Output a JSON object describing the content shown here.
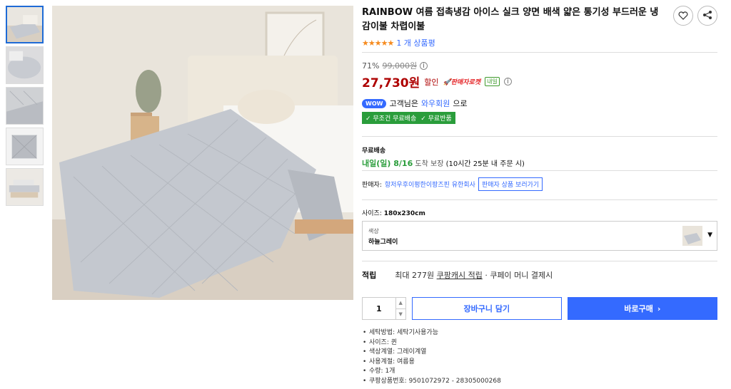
{
  "product": {
    "title": "RAINBOW 여름 접촉냉감 아이스 실크 양면 배색 얇은 통기성 부드러운 냉감이불 차렵이불",
    "stars": "★★★★★",
    "review_count": "1 개 상품평"
  },
  "price": {
    "discount_rate": "71%",
    "original": "99,000원",
    "current": "27,730원",
    "discount_label": "할인",
    "rocket": "🚀판매자로켓",
    "tomorrow": "내일",
    "info": "i"
  },
  "wow": {
    "badge": "WOW",
    "prefix": "고객님은",
    "link": "와우회원",
    "suffix": "으로",
    "benefit1": "✓ 무조건 무료배송",
    "benefit2": "✓ 무료반품"
  },
  "shipping": {
    "label": "무료배송",
    "date": "내일(일) 8/16",
    "arrive": "도착 보장",
    "note": "(10시간 25분 내 주문 시)"
  },
  "seller": {
    "label": "판매자:",
    "name": "항저우후이펑한이팡즈핀 유한회사",
    "button": "판매자 상품 보러가기"
  },
  "size": {
    "label": "사이즈:",
    "value": "180x230cm"
  },
  "color": {
    "label": "색상",
    "value": "하늘그레이"
  },
  "points": {
    "title": "적립",
    "prefix": "최대 277원",
    "link": "쿠팡캐시 적립",
    "suffix": "· 쿠페이 머니 결제시"
  },
  "purchase": {
    "qty": "1",
    "cart_label": "장바구니 담기",
    "buy_label": "바로구매"
  },
  "specs": [
    "세탁방법: 세탁기사용가능",
    "사이즈: 퀸",
    "색상계열: 그레이계열",
    "사용계절: 여름용",
    "수량: 1개",
    "쿠팡상품번호: 9501072972 - 28305000268"
  ]
}
